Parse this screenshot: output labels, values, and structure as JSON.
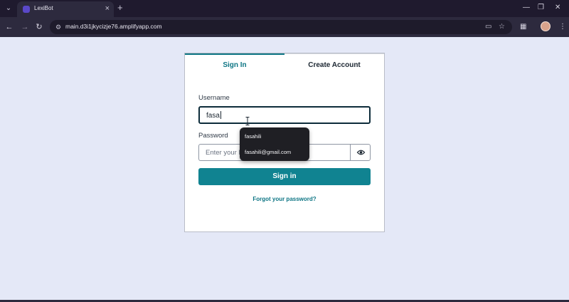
{
  "browser": {
    "tab_title": "LexiBot",
    "url": "main.d3i1jkycizje76.amplifyapp.com",
    "icons": [
      "tab-search-icon",
      "close-icon",
      "plus-icon",
      "minimize-icon",
      "restore-icon",
      "window-close-icon",
      "back-arrow-icon",
      "forward-arrow-icon",
      "reload-icon",
      "site-info-icon",
      "cast-icon",
      "bookmark-star-icon",
      "extensions-icon",
      "profile-avatar",
      "menu-dots-icon"
    ]
  },
  "auth": {
    "tabs": {
      "sign_in": "Sign In",
      "create_account": "Create Account",
      "active": "sign_in"
    },
    "username": {
      "label": "Username",
      "value": "fasa"
    },
    "password": {
      "label": "Password",
      "placeholder": "Enter your Password",
      "icons": [
        "eye-icon"
      ]
    },
    "signin_button": "Sign in",
    "forgot_link": "Forgot your password?"
  },
  "autofill": {
    "suggestions": [
      "fasahili",
      "fasahili@gmail.com"
    ]
  },
  "colors": {
    "accent": "#108391",
    "accent_text": "#0d7584",
    "page_background": "#e4e8f7",
    "chrome": "#2d2a3e"
  }
}
